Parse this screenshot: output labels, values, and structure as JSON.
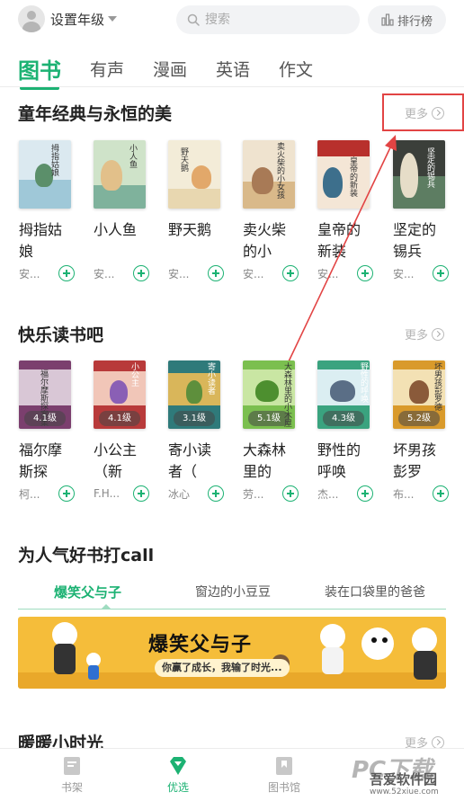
{
  "header": {
    "grade_label": "设置年级",
    "search_placeholder": "搜索",
    "rank_label": "排行榜"
  },
  "tabs": [
    {
      "label": "图书",
      "active": true
    },
    {
      "label": "有声"
    },
    {
      "label": "漫画"
    },
    {
      "label": "英语"
    },
    {
      "label": "作文"
    }
  ],
  "sections": [
    {
      "title": "童年经典与永恒的美",
      "more_label": "更多",
      "books": [
        {
          "name": "拇指姑娘",
          "author": "安...",
          "cover_text": "拇指姑娘"
        },
        {
          "name": "小人鱼",
          "author": "安...",
          "cover_text": "小人鱼"
        },
        {
          "name": "野天鹅",
          "author": "安...",
          "cover_text": "野天鹅"
        },
        {
          "name": "卖火柴的小",
          "author": "安...",
          "cover_text": "卖火柴的小女孩"
        },
        {
          "name": "皇帝的新装",
          "author": "安...",
          "cover_text": "皇帝的新装"
        },
        {
          "name": "坚定的锡兵",
          "author": "安...",
          "cover_text": "坚定的锡兵"
        }
      ]
    },
    {
      "title": "快乐读书吧",
      "more_label": "更多",
      "books": [
        {
          "name": "福尔摩斯探",
          "author": "柯...",
          "level": "4.1级",
          "cover_text": "福尔摩斯探案集"
        },
        {
          "name": "小公主（新",
          "author": "F.H...",
          "level": "4.1级",
          "cover_text": "小公主"
        },
        {
          "name": "寄小读者（",
          "author": "冰心",
          "level": "3.1级",
          "cover_text": "寄小读者"
        },
        {
          "name": "大森林里的",
          "author": "劳...",
          "level": "5.1级",
          "cover_text": "大森林里的小木屋"
        },
        {
          "name": "野性的呼唤",
          "author": "杰...",
          "level": "4.3级",
          "cover_text": "野性的呼唤"
        },
        {
          "name": "坏男孩彭罗",
          "author": "布...",
          "level": "5.2级",
          "cover_text": "坏男孩彭罗德"
        }
      ]
    }
  ],
  "call_section": {
    "title": "为人气好书打call",
    "subtabs": [
      {
        "label": "爆笑父与子",
        "active": true
      },
      {
        "label": "窗边的小豆豆"
      },
      {
        "label": "装在口袋里的爸爸"
      }
    ],
    "banner_title": "爆笑父与子",
    "banner_subtitle": "你赢了成长，我输了时光..."
  },
  "warm_section": {
    "title": "暖暖小时光",
    "more_label": "更多"
  },
  "bottom_nav": [
    {
      "label": "书架",
      "icon": "bookshelf-icon"
    },
    {
      "label": "优选",
      "icon": "diamond-icon",
      "active": true
    },
    {
      "label": "图书馆",
      "icon": "library-icon"
    }
  ],
  "watermark": {
    "logo": "PC下载",
    "text": "吾爱软件园",
    "url": "www.52xiue.com"
  },
  "colors": {
    "accent": "#1cb273",
    "annotation": "#e24444",
    "banner": "#f5bd3a"
  }
}
